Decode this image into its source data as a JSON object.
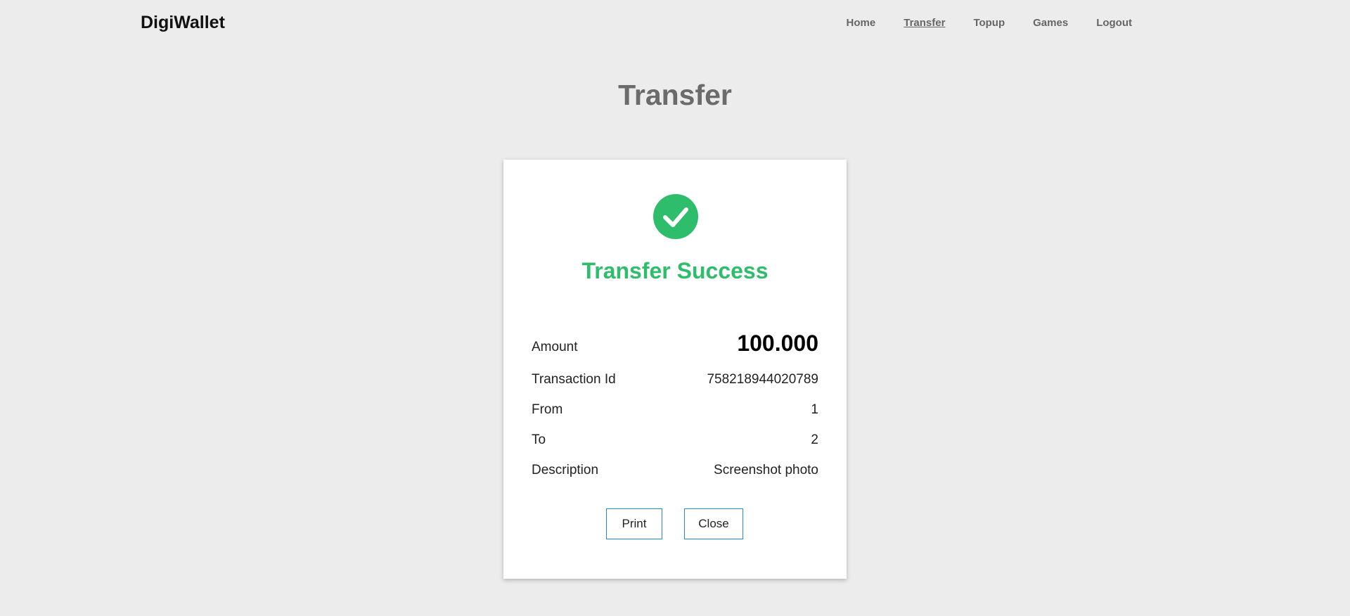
{
  "header": {
    "brand": "DigiWallet",
    "nav": [
      {
        "label": "Home",
        "active": false
      },
      {
        "label": "Transfer",
        "active": true
      },
      {
        "label": "Topup",
        "active": false
      },
      {
        "label": "Games",
        "active": false
      },
      {
        "label": "Logout",
        "active": false
      }
    ]
  },
  "page": {
    "title": "Transfer"
  },
  "card": {
    "icon": "check-circle-icon",
    "status_title": "Transfer Success",
    "details": [
      {
        "label": "Amount",
        "value": "100.000"
      },
      {
        "label": "Transaction Id",
        "value": "758218944020789"
      },
      {
        "label": "From",
        "value": "1"
      },
      {
        "label": "To",
        "value": "2"
      },
      {
        "label": "Description",
        "value": "Screenshot photo"
      }
    ],
    "buttons": {
      "print_label": "Print",
      "close_label": "Close"
    }
  },
  "colors": {
    "background": "#ececec",
    "success": "#2ebd6b",
    "button_border": "#1a8fd8",
    "title_gray": "#6b6b6b"
  }
}
